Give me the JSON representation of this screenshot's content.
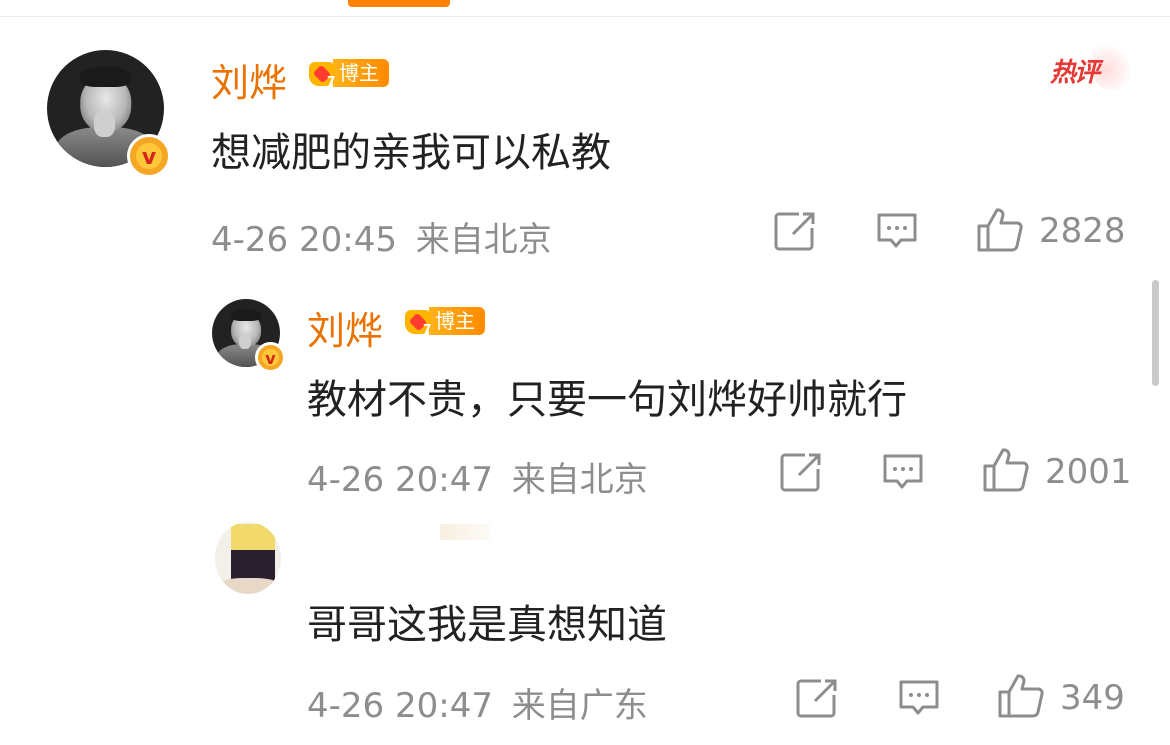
{
  "comments": [
    {
      "username": "刘烨",
      "badge": "博主",
      "text": "想减肥的亲我可以私教",
      "time": "4-26 20:45",
      "location": "来自北京",
      "likes": "2828",
      "hot_label": "热评"
    },
    {
      "username": "刘烨",
      "badge": "博主",
      "text": "教材不贵，只要一句刘烨好帅就行",
      "time": "4-26 20:47",
      "location": "来自北京",
      "likes": "2001"
    },
    {
      "username": "",
      "text": "哥哥这我是真想知道",
      "time": "4-26 20:47",
      "location": "来自广东",
      "likes": "349"
    }
  ],
  "icons": [
    "share-icon",
    "comment-icon",
    "like-icon",
    "verified-icon",
    "crown-icon",
    "hot-comment-icon"
  ],
  "colors": {
    "accent": "#ff8200",
    "username": "#eb7100",
    "meta": "#8d8d8d",
    "hot": "#e53935"
  },
  "badge_level": "7"
}
